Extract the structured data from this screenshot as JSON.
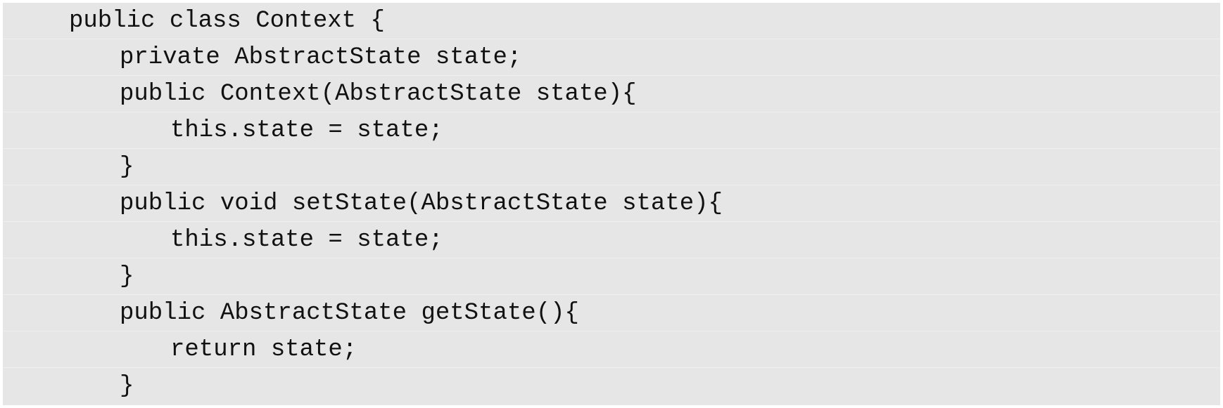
{
  "code": {
    "lines": [
      "public class Context {",
      "private AbstractState state;",
      "public Context(AbstractState state){",
      "this.state = state;",
      "}",
      "public void setState(AbstractState state){",
      "this.state = state;",
      "}",
      "public AbstractState getState(){",
      "return state;",
      "}"
    ]
  },
  "colors": {
    "background": "#e6e6e6",
    "text": "#111111",
    "line_divider": "#efefef"
  }
}
